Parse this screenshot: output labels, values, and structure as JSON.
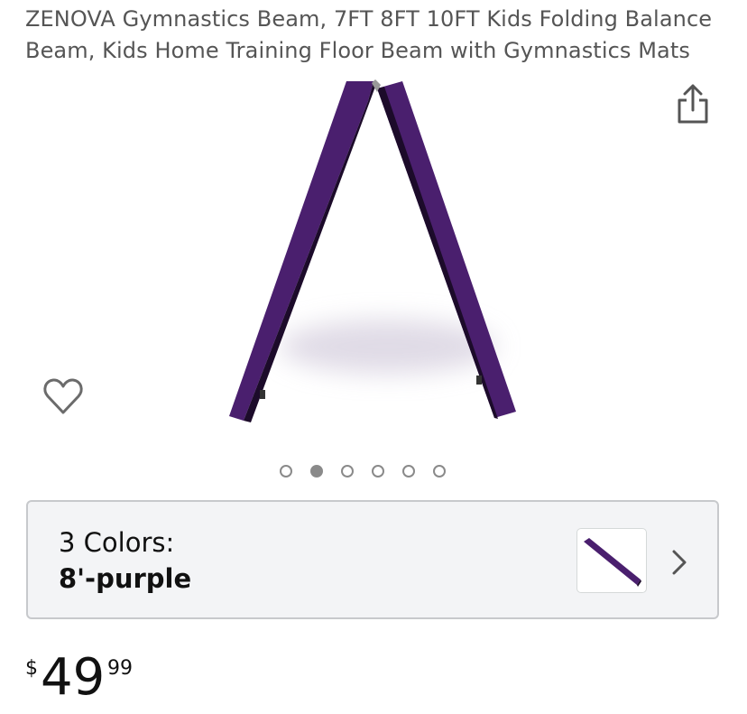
{
  "product": {
    "title": "ZENOVA Gymnastics Beam, 7FT 8FT 10FT Kids Folding Balance Beam, Kids Home Training Floor Beam with Gymnastics Mats"
  },
  "icons": {
    "share": "share-icon",
    "wishlist": "heart-icon",
    "next": "chevron-right-icon"
  },
  "gallery": {
    "image_count": 6,
    "active_index": 1,
    "beam_color": "#4a1f6e"
  },
  "variant": {
    "label": "3 Colors:",
    "selected": "8'-purple"
  },
  "price": {
    "currency_symbol": "$",
    "whole": "49",
    "fraction": "99"
  }
}
